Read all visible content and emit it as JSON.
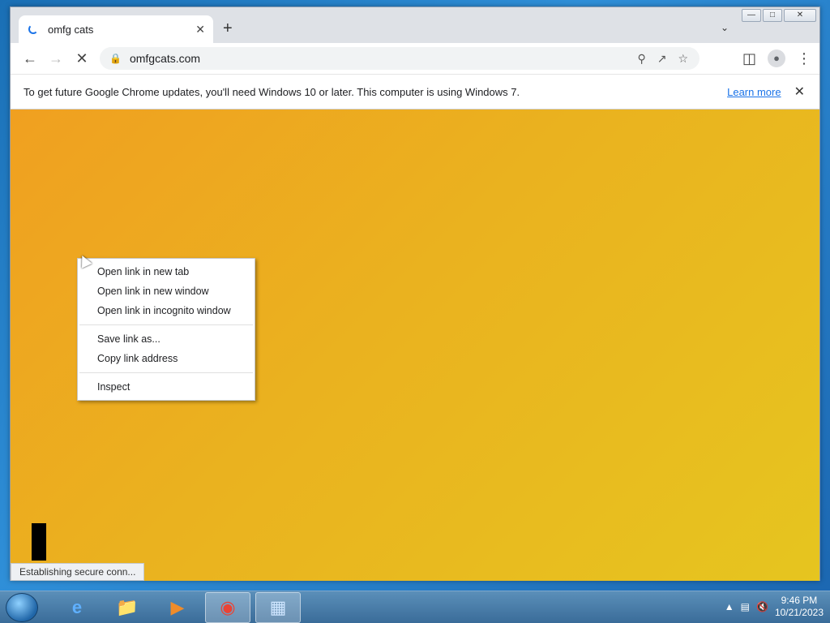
{
  "browser": {
    "tab_title": "omfg cats",
    "url": "omfgcats.com",
    "infobar_text": "To get future Google Chrome updates, you'll need Windows 10 or later. This computer is using Windows 7.",
    "infobar_link": "Learn more",
    "status_text": "Establishing secure conn..."
  },
  "context_menu": {
    "items": [
      "Open link in new tab",
      "Open link in new window",
      "Open link in incognito window",
      "Save link as...",
      "Copy link address",
      "Inspect"
    ]
  },
  "taskbar": {
    "apps": [
      "internet-explorer-icon",
      "file-explorer-icon",
      "media-player-icon",
      "chrome-icon",
      "control-panel-icon"
    ],
    "time": "9:46 PM",
    "date": "10/21/2023"
  },
  "colors": {
    "content_bg_start": "#f0a020",
    "content_bg_end": "#e6c51f",
    "link": "#1a73e8"
  }
}
